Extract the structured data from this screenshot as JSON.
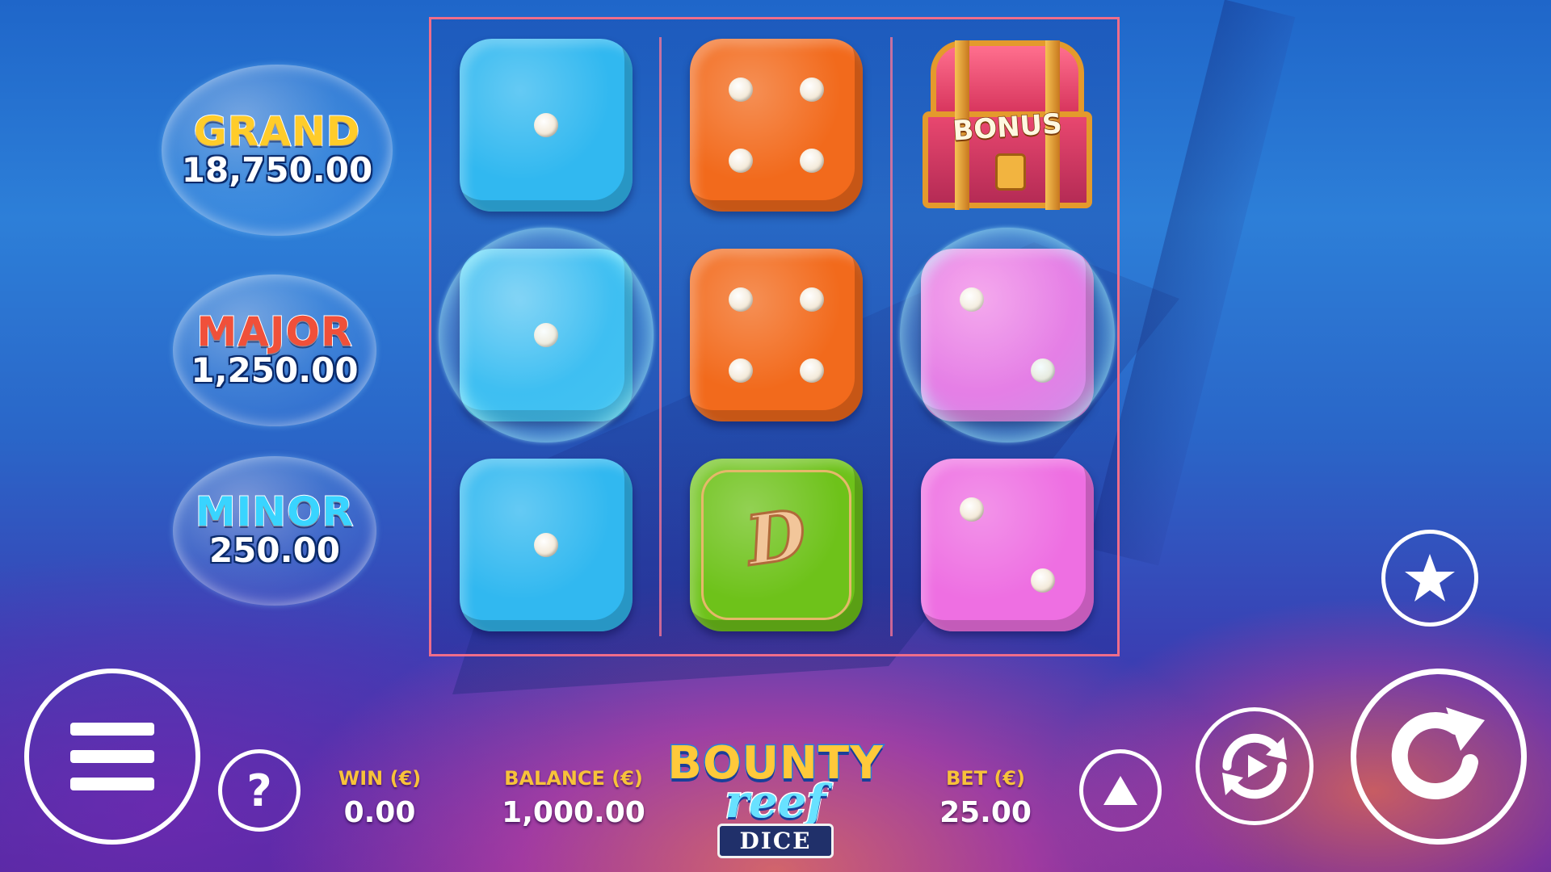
{
  "jackpots": {
    "grand": {
      "title": "GRAND",
      "value": "18,750.00",
      "color": "#ffcc2a"
    },
    "major": {
      "title": "MAJOR",
      "value": "1,250.00",
      "color": "#f0503a"
    },
    "minor": {
      "title": "MINOR",
      "value": "250.00",
      "color": "#39d4ff"
    }
  },
  "reels": [
    [
      {
        "type": "die",
        "face": 1,
        "color": "#31b8f0",
        "bubble": false
      },
      {
        "type": "die",
        "face": 1,
        "color": "#31b8f0",
        "bubble": true
      },
      {
        "type": "die",
        "face": 1,
        "color": "#31b8f0",
        "bubble": false
      }
    ],
    [
      {
        "type": "die",
        "face": 4,
        "color": "#f26a1c",
        "bubble": false
      },
      {
        "type": "die",
        "face": 4,
        "color": "#f26a1c",
        "bubble": false
      },
      {
        "type": "wild",
        "color": "#6ec21a",
        "bubble": false
      }
    ],
    [
      {
        "type": "bonus",
        "label": "BONUS",
        "bubble": false
      },
      {
        "type": "die",
        "face": 2,
        "color": "#ee6fe2",
        "bubble": true
      },
      {
        "type": "die",
        "face": 2,
        "color": "#ee6fe2",
        "bubble": false
      }
    ]
  ],
  "footer": {
    "win_label": "WIN (€)",
    "win_value": "0.00",
    "balance_label": "BALANCE (€)",
    "balance_value": "1,000.00",
    "bet_label": "BET (€)",
    "bet_value": "25.00"
  },
  "logo": {
    "line1": "BOUNTY",
    "line2": "reef",
    "line3": "DICE"
  },
  "controls": {
    "menu_icon": "hamburger-icon",
    "help_glyph": "?",
    "favorite_icon": "star-icon",
    "bet_icon": "triangle-up-icon",
    "autoplay_icon": "autoplay-icon",
    "spin_icon": "refresh-icon"
  }
}
